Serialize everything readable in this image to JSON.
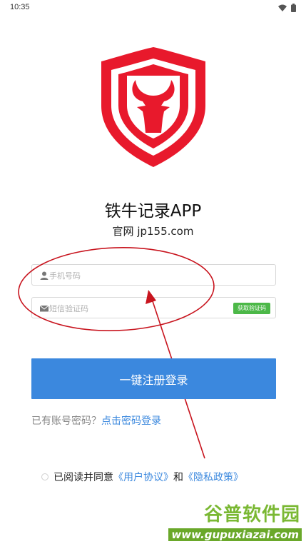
{
  "status_bar": {
    "time": "10:35"
  },
  "app": {
    "name": "铁牛记录APP",
    "site": "官网 jp155.com"
  },
  "form": {
    "phone_placeholder": "手机号码",
    "code_placeholder": "短信验证码",
    "get_code_label": "获取验证码",
    "login_button": "一键注册登录"
  },
  "password_login": {
    "prefix": "已有账号密码？",
    "link": "点击密码登录"
  },
  "agreement": {
    "prefix": "已阅读并同意",
    "user_agreement": "《用户协议》",
    "and": "和",
    "privacy_policy": "《隐私政策》"
  },
  "watermark": {
    "title": "谷普软件园",
    "url": "www.gupuxiazai.com"
  },
  "colors": {
    "brand_red": "#e8192c",
    "primary_blue": "#3b88de",
    "code_green": "#4cb848",
    "annotation_red": "#c8141e"
  }
}
